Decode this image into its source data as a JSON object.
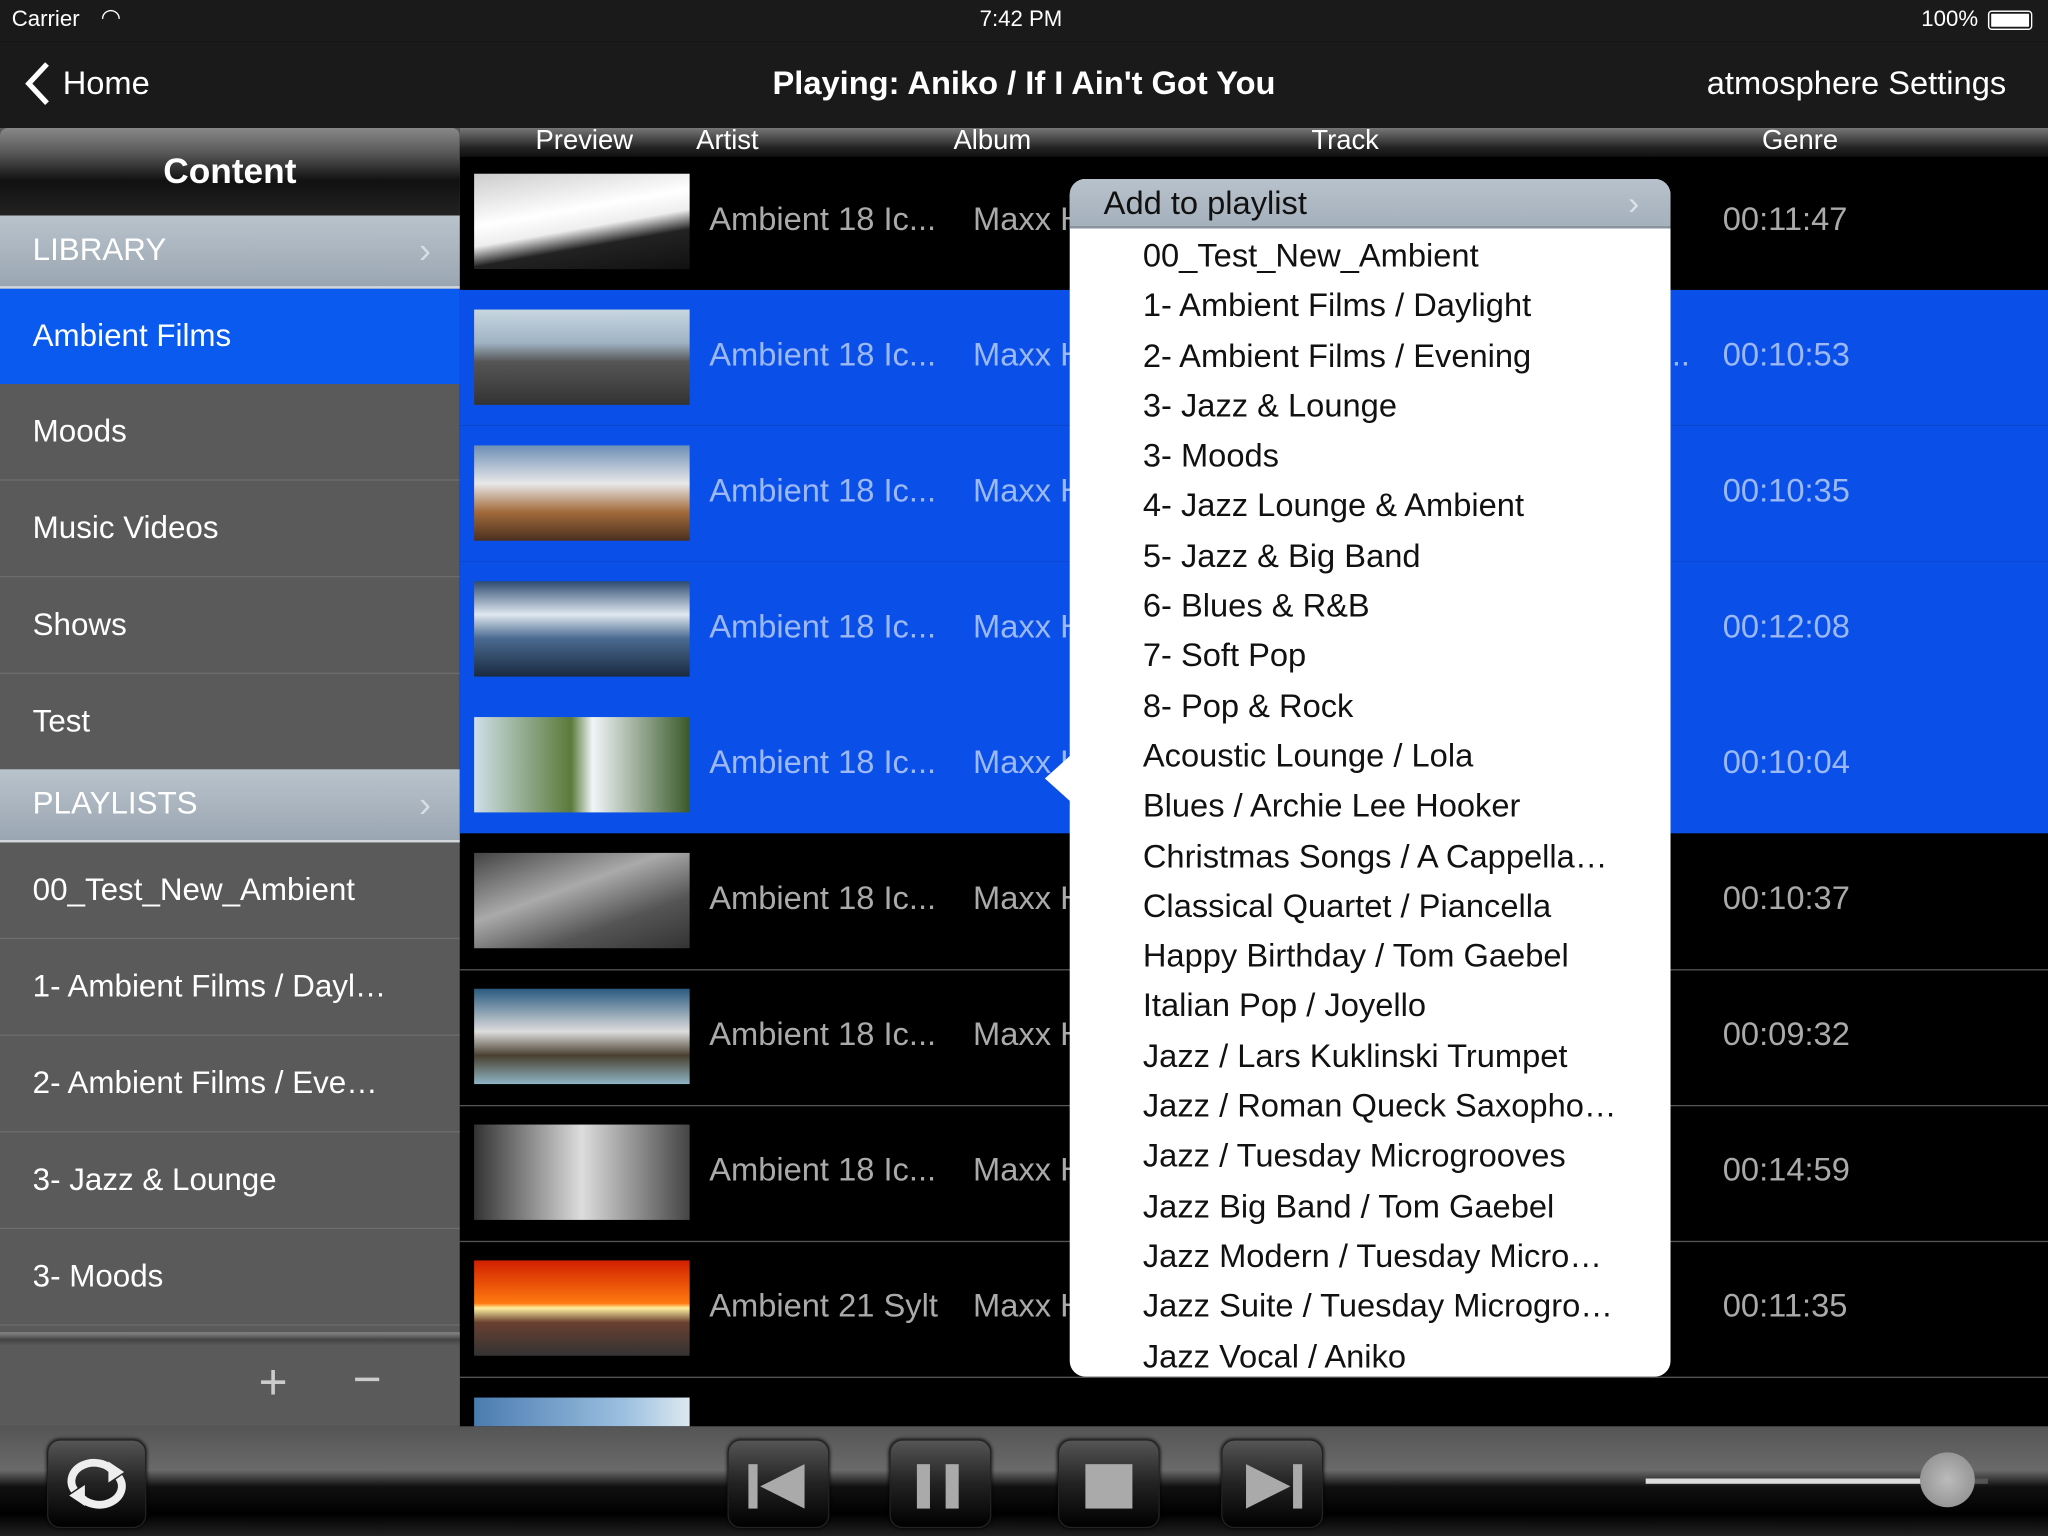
{
  "status_bar": {
    "carrier": "Carrier",
    "time": "7:42 PM",
    "battery": "100%"
  },
  "nav": {
    "back_label": "Home",
    "title": "Playing: Aniko / If I Ain't Got You",
    "settings_label": "atmosphere Settings"
  },
  "sidebar": {
    "header": "Content",
    "library_label": "LIBRARY",
    "library_items": [
      {
        "label": "Ambient Films",
        "selected": true
      },
      {
        "label": "Moods"
      },
      {
        "label": "Music Videos"
      },
      {
        "label": "Shows"
      },
      {
        "label": "Test"
      }
    ],
    "playlists_label": "PLAYLISTS",
    "playlist_items": [
      {
        "label": "00_Test_New_Ambient"
      },
      {
        "label": "1- Ambient Films / Dayl…"
      },
      {
        "label": "2- Ambient Films / Eve…"
      },
      {
        "label": "3- Jazz & Lounge"
      },
      {
        "label": "3- Moods"
      }
    ],
    "add_label": "+",
    "remove_label": "−"
  },
  "columns": {
    "preview": "Preview",
    "artist": "Artist",
    "album": "Album",
    "track": "Track",
    "genre": "Genre"
  },
  "rows": [
    {
      "artist": "Ambient 18 Ic...",
      "album": "Maxx H",
      "duration": "00:11:47",
      "selected": false
    },
    {
      "artist": "Ambient 18 Ic...",
      "album": "Maxx H",
      "track_tail": "..",
      "duration": "00:10:53",
      "selected": true
    },
    {
      "artist": "Ambient 18 Ic...",
      "album": "Maxx H",
      "duration": "00:10:35",
      "selected": true
    },
    {
      "artist": "Ambient 18 Ic...",
      "album": "Maxx H",
      "duration": "00:12:08",
      "selected": true
    },
    {
      "artist": "Ambient 18 Ic...",
      "album": "Maxx H",
      "duration": "00:10:04",
      "selected": true
    },
    {
      "artist": "Ambient 18 Ic...",
      "album": "Maxx H",
      "duration": "00:10:37",
      "selected": false
    },
    {
      "artist": "Ambient 18 Ic...",
      "album": "Maxx H",
      "duration": "00:09:32",
      "selected": false
    },
    {
      "artist": "Ambient 18 Ic...",
      "album": "Maxx H",
      "duration": "00:14:59",
      "selected": false
    },
    {
      "artist": "Ambient 21 Sylt",
      "album": "Maxx H",
      "duration": "00:11:35",
      "selected": false
    }
  ],
  "popover": {
    "title": "Add to playlist",
    "items": [
      "00_Test_New_Ambient",
      "1- Ambient Films / Daylight",
      "2- Ambient Films / Evening",
      "3- Jazz & Lounge",
      "3- Moods",
      "4- Jazz Lounge & Ambient",
      "5- Jazz & Big Band",
      "6- Blues & R&B",
      "7- Soft Pop",
      "8- Pop & Rock",
      "Acoustic Lounge / Lola",
      "Blues / Archie Lee Hooker",
      "Christmas Songs / A Cappella…",
      "Classical Quartet / Piancella",
      "Happy Birthday / Tom Gaebel",
      "Italian Pop / Joyello",
      "Jazz / Lars Kuklinski Trumpet",
      "Jazz / Roman Queck Saxopho…",
      "Jazz / Tuesday Microgrooves",
      "Jazz Big Band / Tom Gaebel",
      "Jazz Modern / Tuesday Micro…",
      "Jazz Suite / Tuesday Microgro…",
      "Jazz Vocal / Aniko"
    ]
  },
  "player": {
    "volume": 0.88,
    "icons": [
      "repeat-icon",
      "previous-icon",
      "pause-icon",
      "stop-icon",
      "next-icon"
    ]
  },
  "colors": {
    "selection": "#0a50e8",
    "sidebar_selection": "#0a5af0"
  }
}
